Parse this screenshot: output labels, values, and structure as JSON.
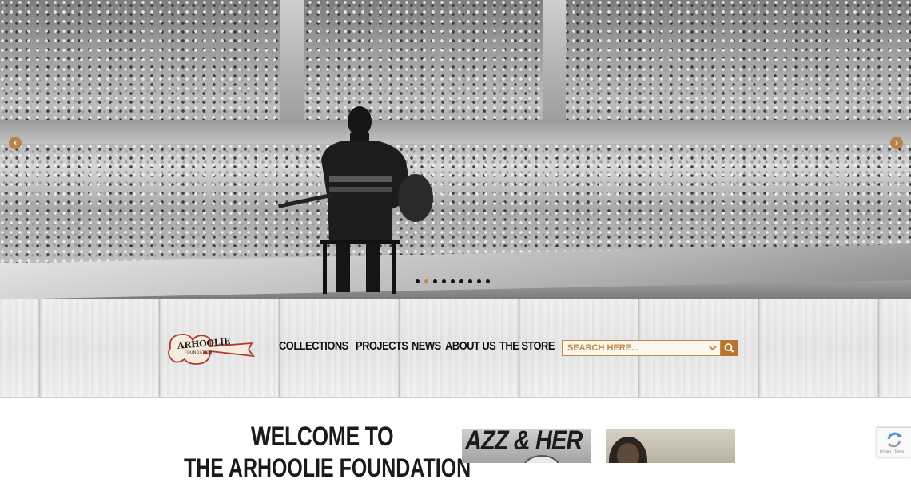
{
  "hero": {
    "prev_label": "‹",
    "next_label": "›",
    "slide_count": 9,
    "active_slide": 2
  },
  "nav": {
    "logo_text": "ARHOOLIE",
    "logo_sub": "FOUNDATION",
    "items": [
      {
        "label": "COLLECTIONS"
      },
      {
        "label": "PROJECTS"
      },
      {
        "label": "NEWS"
      },
      {
        "label": "ABOUT US"
      },
      {
        "label": "THE STORE"
      }
    ],
    "search": {
      "placeholder": "SEARCH HERE..."
    }
  },
  "content": {
    "welcome_line1": "WELCOME TO",
    "welcome_line2": "THE ARHOOLIE FOUNDATION",
    "thumb_a_text": "AZZ & HER",
    "thumb_b_text": ""
  },
  "recaptcha": {
    "terms": "Privacy - Terms"
  },
  "colors": {
    "accent": "#c38a3e",
    "search_button": "#b8732f",
    "text": "#111111"
  },
  "icons": {
    "prev": "chevron-left-icon",
    "next": "chevron-right-icon",
    "search": "magnifier-icon",
    "dropdown": "chevron-down-icon",
    "recaptcha": "recaptcha-icon"
  }
}
